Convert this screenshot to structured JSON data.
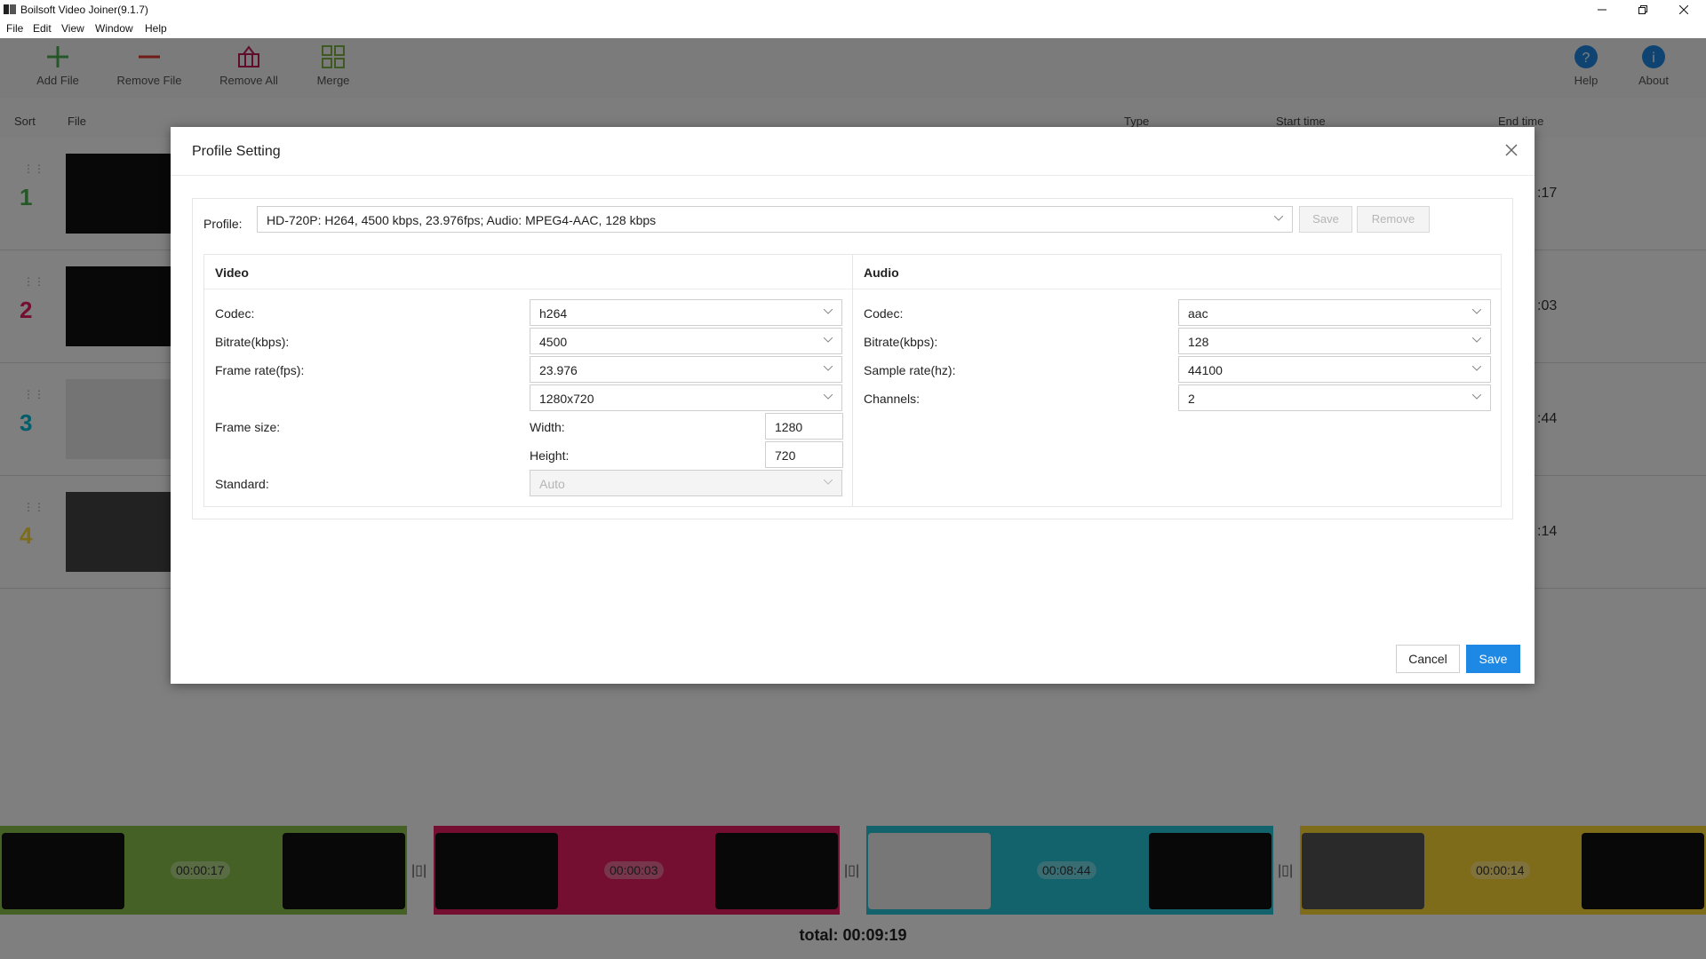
{
  "window": {
    "title": "Boilsoft Video Joiner(9.1.7)"
  },
  "menu": [
    "File",
    "Edit",
    "View",
    "Window",
    "Help"
  ],
  "toolbar": {
    "add_file": "Add File",
    "remove_file": "Remove File",
    "remove_all": "Remove All",
    "merge": "Merge",
    "help": "Help",
    "about": "About"
  },
  "columns": {
    "sort": "Sort",
    "file": "File",
    "type": "Type",
    "start_time": "Start time",
    "end_time": "End time"
  },
  "rows": [
    {
      "index": "1",
      "end_time": ":17",
      "color": "#4caf50"
    },
    {
      "index": "2",
      "end_time": ":03",
      "color": "#e91e63"
    },
    {
      "index": "3",
      "end_time": ":44",
      "color": "#00bcd4"
    },
    {
      "index": "4",
      "end_time": ":14",
      "color": "#fdd835"
    }
  ],
  "timeline": {
    "segments": [
      {
        "duration": "00:00:17",
        "color": "#8bc34a"
      },
      {
        "duration": "00:00:03",
        "color": "#e91e63"
      },
      {
        "duration": "00:08:44",
        "color": "#26c6da"
      },
      {
        "duration": "00:00:14",
        "color": "#fdd835"
      }
    ],
    "total": "total: 00:09:19"
  },
  "dialog": {
    "title": "Profile Setting",
    "profile_label": "Profile:",
    "profile_value": "HD-720P: H264, 4500 kbps, 23.976fps; Audio: MPEG4-AAC, 128 kbps",
    "save_profile": "Save",
    "remove_profile": "Remove",
    "video": {
      "title": "Video",
      "codec_label": "Codec:",
      "codec": "h264",
      "bitrate_label": "Bitrate(kbps):",
      "bitrate": "4500",
      "framerate_label": "Frame rate(fps):",
      "framerate": "23.976",
      "framesize_label": "Frame size:",
      "framesize": "1280x720",
      "width_label": "Width:",
      "width": "1280",
      "height_label": "Height:",
      "height": "720",
      "standard_label": "Standard:",
      "standard": "Auto"
    },
    "audio": {
      "title": "Audio",
      "codec_label": "Codec:",
      "codec": "aac",
      "bitrate_label": "Bitrate(kbps):",
      "bitrate": "128",
      "samplerate_label": "Sample rate(hz):",
      "samplerate": "44100",
      "channels_label": "Channels:",
      "channels": "2"
    },
    "cancel": "Cancel",
    "save": "Save"
  },
  "colors": {
    "accent": "#1e88e5",
    "overlay": "rgba(0,0,0,0.5)"
  }
}
